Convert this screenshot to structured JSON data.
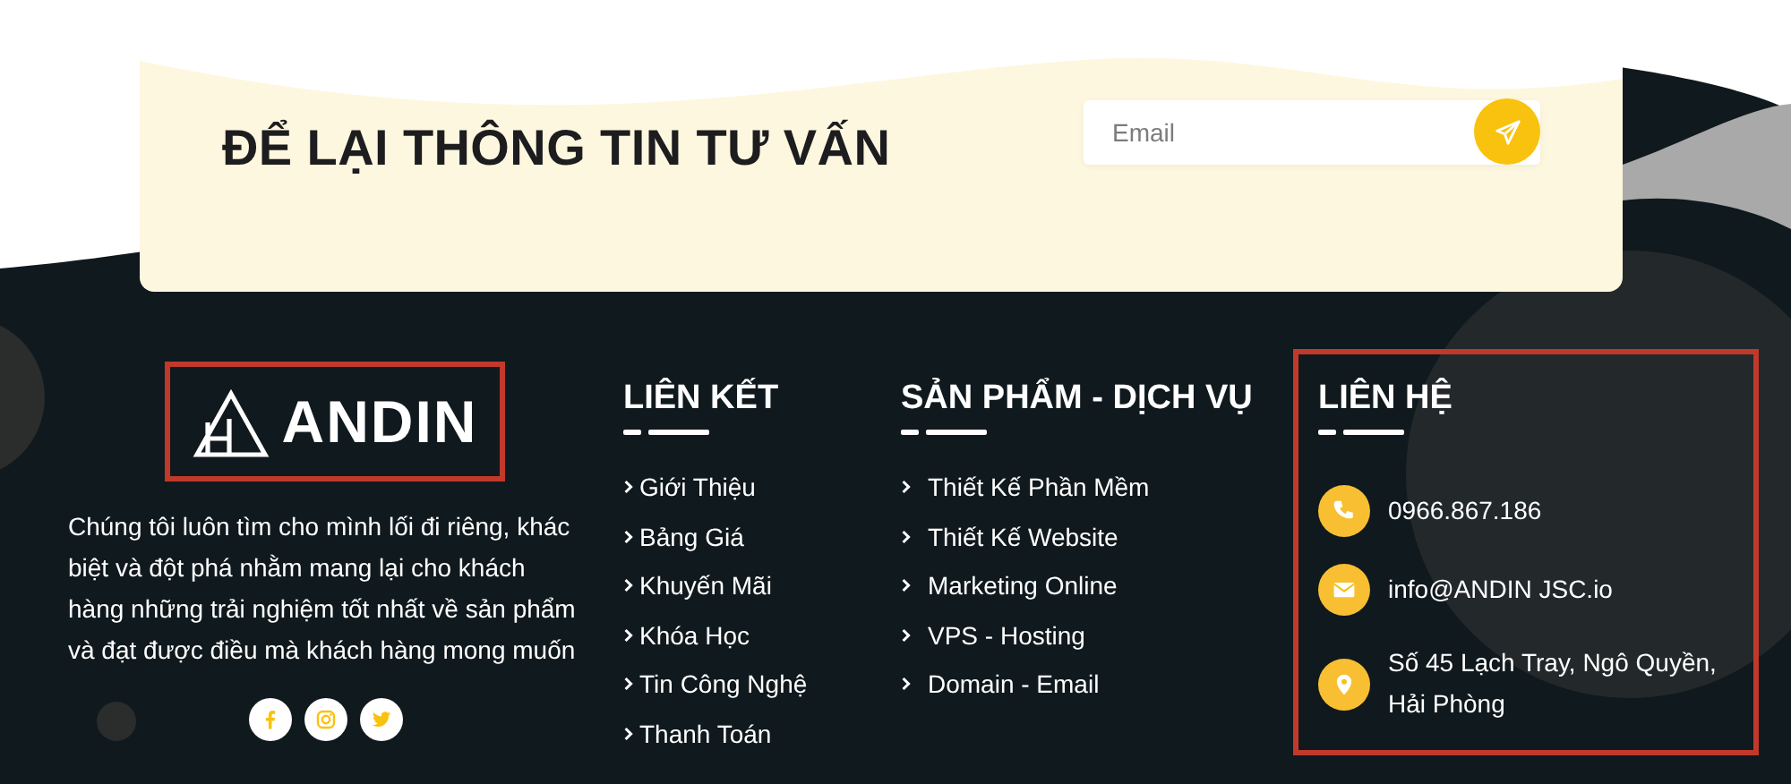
{
  "consult_card": {
    "title": "ĐỂ LẠI THÔNG TIN TƯ VẤN",
    "email_field": {
      "placeholder": "Email"
    }
  },
  "about": {
    "logo": {
      "text": "ANDIN",
      "highlighted": true
    },
    "description": "Chúng tôi luôn tìm cho mình lối đi riêng, khác biệt và đột phá nhằm mang lại cho khách hàng những trải nghiệm tốt nhất về sản phẩm và đạt được điều mà khách hàng mong muốn",
    "social": [
      {
        "kind": "facebook"
      },
      {
        "kind": "instagram"
      },
      {
        "kind": "twitter"
      }
    ]
  },
  "link_columns": [
    {
      "heading": "LIÊN KẾT",
      "items": [
        "Giới Thiệu",
        "Bảng Giá",
        "Khuyến Mãi",
        "Khóa Học",
        "Tin Công Nghệ",
        "Thanh Toán"
      ]
    },
    {
      "heading": "SẢN PHẨM - DỊCH VỤ",
      "items": [
        "Thiết Kế Phần Mềm",
        "Thiết Kế Website",
        "Marketing Online",
        "VPS - Hosting",
        "Domain - Email"
      ]
    }
  ],
  "contact": {
    "heading": "LIÊN HỆ",
    "highlighted": true,
    "items": [
      {
        "kind": "phone",
        "text": "0966.867.186"
      },
      {
        "kind": "email",
        "text": "info@ANDIN JSC.io"
      },
      {
        "kind": "address",
        "text": "Số 45 Lạch Tray, Ngô Quyền, Hải Phòng"
      }
    ]
  }
}
